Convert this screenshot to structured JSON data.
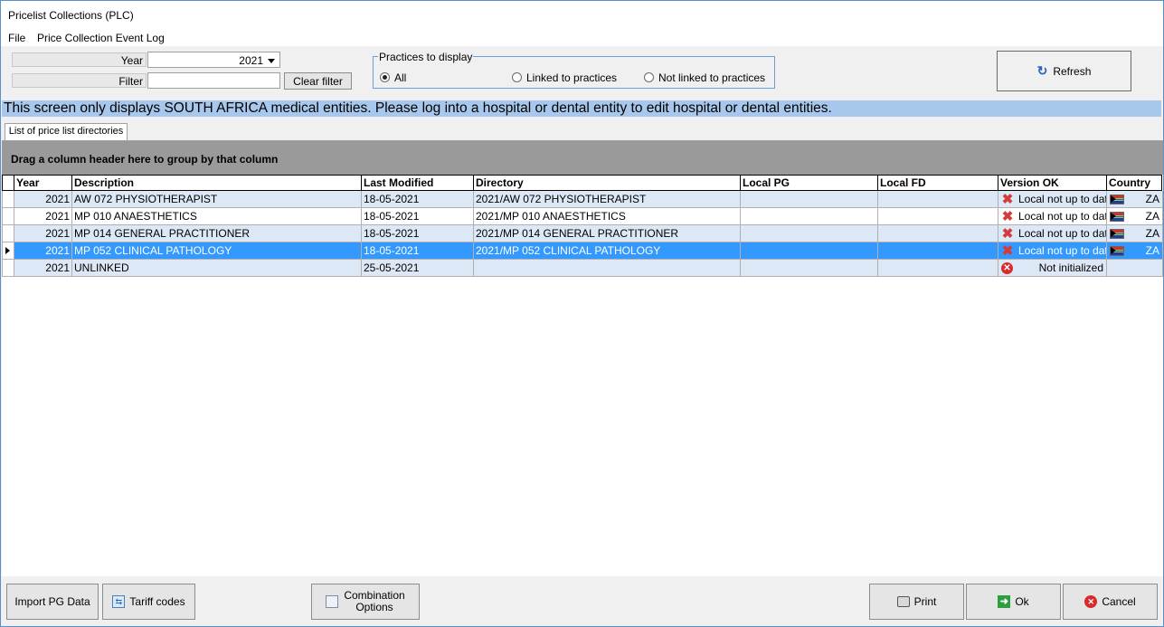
{
  "window": {
    "title": "Pricelist Collections (PLC)"
  },
  "menu": [
    "File",
    "Price Collection Event Log"
  ],
  "filters": {
    "year_label": "Year",
    "year_value": "2021",
    "filter_label": "Filter",
    "filter_value": "",
    "clear_filter": "Clear filter"
  },
  "practices": {
    "legend": "Practices to display",
    "options": [
      "All",
      "Linked to practices",
      "Not linked to practices"
    ],
    "selected": "All"
  },
  "refresh_label": "Refresh",
  "banner": "This screen only displays SOUTH AFRICA medical entities. Please log into a hospital or dental entity to edit hospital or dental entities.",
  "tab_label": "List of price list directories",
  "grid": {
    "group_hint": "Drag a column header here to group by that column",
    "columns": [
      "Year",
      "Description",
      "Last Modified",
      "Directory",
      "Local PG",
      "Local FD",
      "Version OK",
      "Country"
    ],
    "rows": [
      {
        "year": "2021",
        "description": "AW 072 PHYSIOTHERAPIST",
        "last_modified": "18-05-2021",
        "directory": "2021/AW 072 PHYSIOTHERAPIST",
        "local_pg": "",
        "local_fd": "",
        "version": "Local not up to date",
        "version_icon": "red-x-icon",
        "country": "ZA"
      },
      {
        "year": "2021",
        "description": "MP 010 ANAESTHETICS",
        "last_modified": "18-05-2021",
        "directory": "2021/MP 010 ANAESTHETICS",
        "local_pg": "",
        "local_fd": "",
        "version": "Local not up to date",
        "version_icon": "red-x-icon",
        "country": "ZA"
      },
      {
        "year": "2021",
        "description": "MP 014 GENERAL PRACTITIONER",
        "last_modified": "18-05-2021",
        "directory": "2021/MP 014 GENERAL PRACTITIONER",
        "local_pg": "",
        "local_fd": "",
        "version": "Local not up to date",
        "version_icon": "red-x-icon",
        "country": "ZA"
      },
      {
        "year": "2021",
        "description": "MP 052 CLINICAL PATHOLOGY",
        "last_modified": "18-05-2021",
        "directory": "2021/MP 052 CLINICAL PATHOLOGY",
        "local_pg": "",
        "local_fd": "",
        "version": "Local not up to date",
        "version_icon": "red-x-icon",
        "country": "ZA",
        "selected": true
      },
      {
        "year": "2021",
        "description": "UNLINKED",
        "last_modified": "25-05-2021",
        "directory": "",
        "local_pg": "",
        "local_fd": "",
        "version": "Not initialized",
        "version_icon": "error-circle-icon",
        "country": ""
      }
    ]
  },
  "bottom_buttons": {
    "import": "Import PG Data",
    "tariff": "Tariff codes",
    "combination_line1": "Combination",
    "combination_line2": "Options",
    "print": "Print",
    "ok": "Ok",
    "cancel": "Cancel"
  },
  "colors": {
    "selection": "#3399ff",
    "banner": "#a7c8ec",
    "alt_row": "#dde8f6",
    "group_panel": "#9a9a9a"
  }
}
